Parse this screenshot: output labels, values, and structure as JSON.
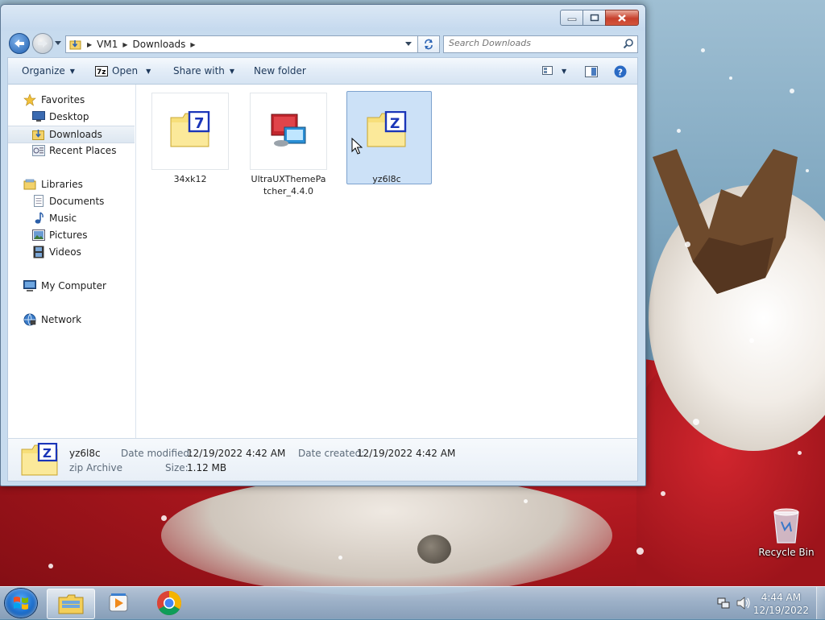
{
  "window": {
    "controls": {
      "minimize": "minimize",
      "maximize": "maximize",
      "close": "close"
    }
  },
  "address": {
    "segments": [
      "VM1",
      "Downloads"
    ]
  },
  "search": {
    "placeholder": "Search Downloads"
  },
  "toolbar": {
    "organize": "Organize",
    "open": "Open",
    "share_with": "Share with",
    "new_folder": "New folder"
  },
  "nav": {
    "favorites": "Favorites",
    "desktop": "Desktop",
    "downloads": "Downloads",
    "recent_places": "Recent Places",
    "libraries": "Libraries",
    "documents": "Documents",
    "music": "Music",
    "pictures": "Pictures",
    "videos": "Videos",
    "my_computer": "My Computer",
    "network": "Network"
  },
  "files": [
    {
      "name": "34xk12",
      "icon": "7z-archive-icon",
      "selected": false
    },
    {
      "name": "UltraUXThemePatcher_4.4.0",
      "icon": "installer-icon",
      "selected": false
    },
    {
      "name": "yz6l8c",
      "icon": "zip-archive-icon",
      "selected": true
    }
  ],
  "details": {
    "name": "yz6l8c",
    "type": "zip Archive",
    "date_modified_label": "Date modified:",
    "date_modified": "12/19/2022 4:42 AM",
    "date_created_label": "Date created:",
    "date_created": "12/19/2022 4:42 AM",
    "size_label": "Size:",
    "size": "1.12 MB"
  },
  "desktop": {
    "recycle_bin": "Recycle Bin"
  },
  "taskbar": {
    "time": "4:44 AM",
    "date": "12/19/2022",
    "apps": [
      "file-explorer-icon",
      "media-player-icon",
      "chrome-icon"
    ]
  },
  "colors": {
    "selection": "#cce1f7",
    "toolbar_text": "#1e395b",
    "zip_blue": "#1a35b8",
    "folder_yellow": "#f7df7a"
  }
}
